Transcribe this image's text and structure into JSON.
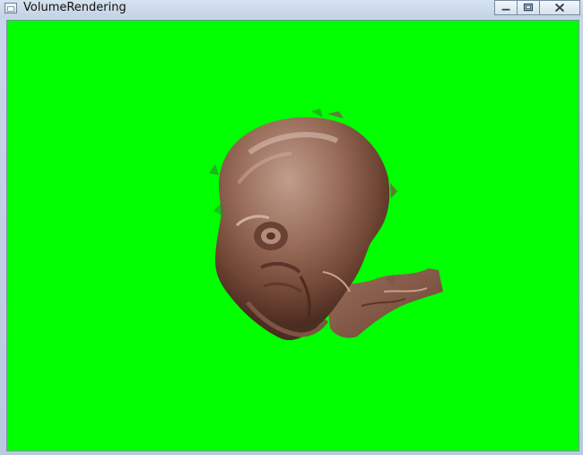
{
  "window": {
    "title": "VolumeRendering",
    "controls": {
      "minimize_icon": "minimize-icon",
      "restore_icon": "restore-icon",
      "close_icon": "close-icon"
    }
  },
  "viewport": {
    "background_color": "#00ff00",
    "object_color": "#9b6f59",
    "object": "volume-rendered-head"
  }
}
